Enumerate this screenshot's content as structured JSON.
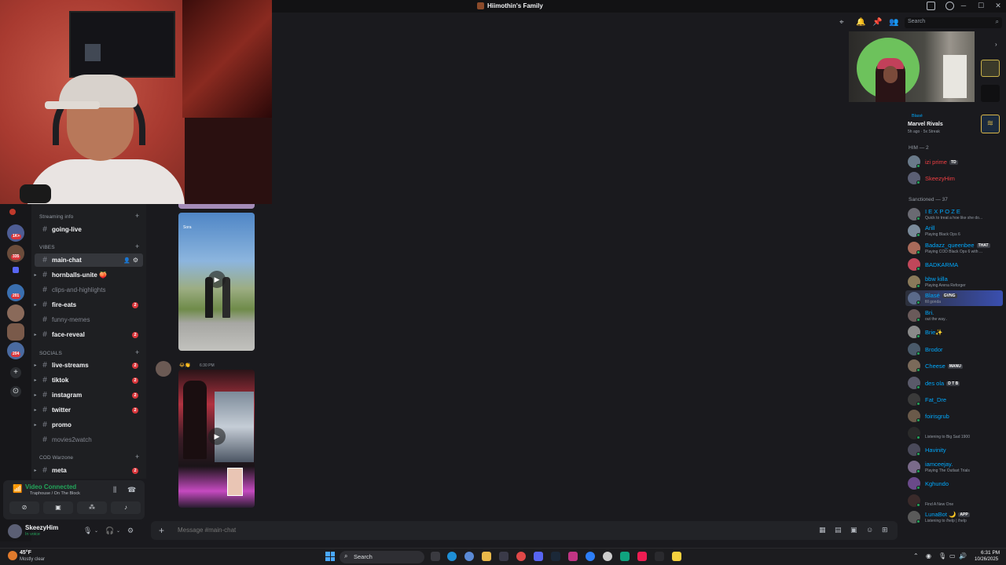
{
  "window": {
    "title": "Hiimothin's Family"
  },
  "toolbar": {
    "search_placeholder": "Search"
  },
  "channels": {
    "categories": [
      {
        "label": "Streaming info"
      },
      {
        "label": "VIBES"
      },
      {
        "label": "SOCIALS"
      },
      {
        "label": "COD Warzone"
      }
    ],
    "items": [
      {
        "name": "going-live",
        "unread": true
      },
      {
        "name": "main-chat",
        "active": true
      },
      {
        "name": "hornballs-unite 🍑",
        "unread": true
      },
      {
        "name": "clips-and-highlights",
        "unread": false
      },
      {
        "name": "fire-eats",
        "badge": "2"
      },
      {
        "name": "funny-memes",
        "unread": false
      },
      {
        "name": "face-reveal",
        "badge": "2"
      },
      {
        "name": "live-streams",
        "badge": "2"
      },
      {
        "name": "tiktok",
        "badge": "2"
      },
      {
        "name": "instagram",
        "badge": "2"
      },
      {
        "name": "twitter",
        "badge": "2"
      },
      {
        "name": "promo",
        "unread": true
      },
      {
        "name": "movies2watch",
        "unread": false
      },
      {
        "name": "meta",
        "badge": "2"
      }
    ]
  },
  "rail": {
    "badges": [
      "1K+",
      "335",
      "201",
      "204"
    ]
  },
  "voice": {
    "status": "Video Connected",
    "channel": "Traphouse / On The Block"
  },
  "user": {
    "name": "SkeezyHim",
    "status": "In voice"
  },
  "chat": {
    "video_label": "Sora",
    "message_time": "6:30 PM",
    "composer_placeholder": "Message #main-chat"
  },
  "activity": {
    "user": "Blasé",
    "game": "Marvel Rivals",
    "detail": "5h ago · 5x Streak"
  },
  "members": {
    "groups": [
      {
        "label": "HIM — 2"
      },
      {
        "label": "Sanctioned — 37"
      }
    ],
    "him": [
      {
        "name": "izi prime",
        "tag": "TD",
        "color": "#f23f43"
      },
      {
        "name": "SkeezyHim",
        "tag": "",
        "color": "#f23f43"
      }
    ],
    "sanctioned": [
      {
        "name": "I E X P O Z E",
        "status": "Quick to treat a hoe like she do...",
        "color": "#00a8fc"
      },
      {
        "name": "Arill",
        "status": "Playing Black Ops 6",
        "color": "#00a8fc"
      },
      {
        "name": "Badazz_queenbee",
        "tag": "THAT",
        "status": "Playing COD Black Ops 6 with ...",
        "color": "#00a8fc"
      },
      {
        "name": "BADKARMA",
        "status": "",
        "color": "#00a8fc"
      },
      {
        "name": "bbw killa",
        "status": "Playing Arena Reforger",
        "color": "#00a8fc"
      },
      {
        "name": "Blasé",
        "tag": "GVNG",
        "status": "fill gonda",
        "color": "#00a8fc"
      },
      {
        "name": "Bri.",
        "status": "out the way..",
        "color": "#00a8fc"
      },
      {
        "name": "Brie✨",
        "status": "",
        "color": "#00a8fc"
      },
      {
        "name": "Brodor",
        "status": "",
        "color": "#00a8fc"
      },
      {
        "name": "Cheese",
        "tag": "MANU",
        "status": "",
        "color": "#00a8fc"
      },
      {
        "name": "des ola",
        "tag": "D T B",
        "status": "",
        "color": "#00a8fc"
      },
      {
        "name": "Fat_Dre",
        "status": "",
        "color": "#00a8fc"
      },
      {
        "name": "foirisgrub",
        "status": "",
        "color": "#00a8fc"
      },
      {
        "name": "",
        "status": "Listening to Big Sad 1900",
        "color": "#00a8fc"
      },
      {
        "name": "Havinity",
        "status": "",
        "color": "#00a8fc"
      },
      {
        "name": "iamceejay.",
        "status": "Playing The Outlast Trials",
        "color": "#00a8fc"
      },
      {
        "name": "Kghundo",
        "status": "",
        "color": "#00a8fc"
      },
      {
        "name": "",
        "status": "Find A New One",
        "color": "#f23f43"
      },
      {
        "name": "LunaBot 🌙",
        "tag": "APP",
        "status": "Listening to /help | /help",
        "color": "#00a8fc"
      }
    ]
  },
  "taskbar": {
    "temperature": "45°F",
    "weather": "Mostly clear",
    "search": "Search",
    "time": "6:31 PM",
    "date": "10/26/2025"
  }
}
